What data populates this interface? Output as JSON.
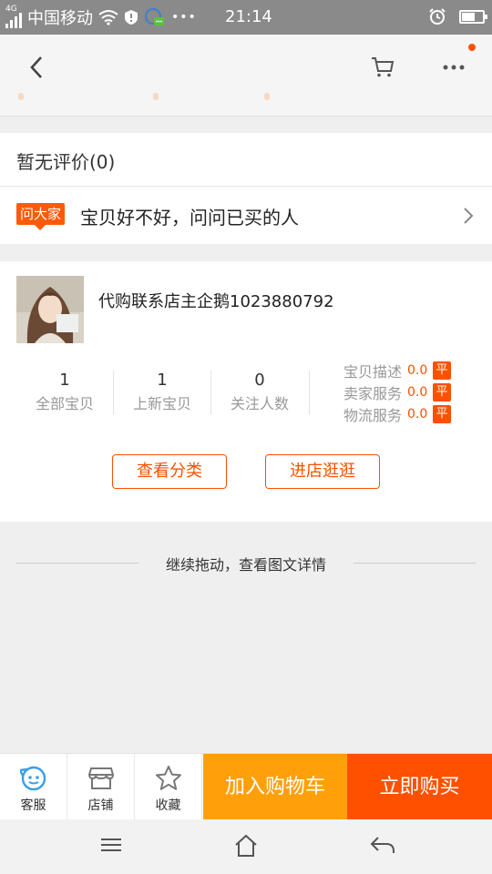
{
  "status_bar": {
    "network": "4G",
    "carrier": "中国移动",
    "more": "•••",
    "time": "21:14",
    "battery_level": 0.65
  },
  "nav": {
    "back_icon": "chevron-left-icon",
    "cart_icon": "cart-icon",
    "more_icon": "more-dots-icon"
  },
  "reviews": {
    "title": "暂无评价(0)"
  },
  "ask": {
    "badge": "问大家",
    "text": "宝贝好不好，问问已买的人"
  },
  "shop": {
    "name": "代购联系店主企鹅1023880792",
    "stats": [
      {
        "value": "1",
        "label": "全部宝贝"
      },
      {
        "value": "1",
        "label": "上新宝贝"
      },
      {
        "value": "0",
        "label": "关注人数"
      }
    ],
    "ratings": [
      {
        "label": "宝贝描述",
        "score": "0.0",
        "tag": "平"
      },
      {
        "label": "卖家服务",
        "score": "0.0",
        "tag": "平"
      },
      {
        "label": "物流服务",
        "score": "0.0",
        "tag": "平"
      }
    ],
    "view_categories": "查看分类",
    "visit_store": "进店逛逛"
  },
  "continue_text": "继续拖动，查看图文详情",
  "action_bar": {
    "service": "客服",
    "store": "店铺",
    "favorite": "收藏",
    "add_to_cart": "加入购物车",
    "buy_now": "立即购买"
  },
  "colors": {
    "accent": "#ff5000",
    "cart_orange": "#ffa00a",
    "service_blue": "#3a9ee8"
  }
}
